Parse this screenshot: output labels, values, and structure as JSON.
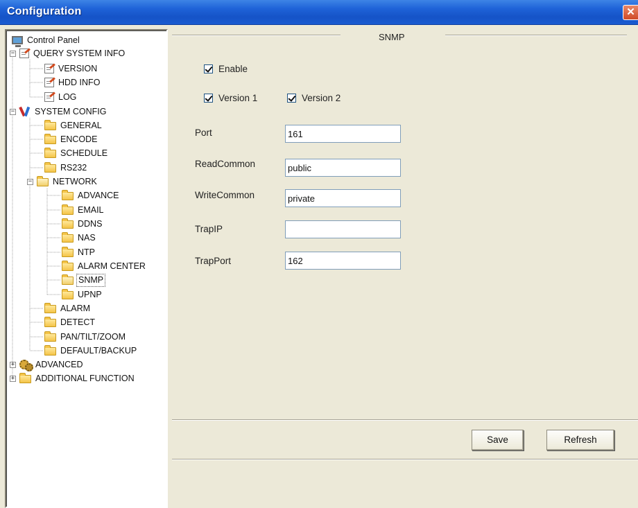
{
  "window": {
    "title": "Configuration",
    "close_glyph": "✕"
  },
  "tree": {
    "root": "Control Panel",
    "query_system_info": "QUERY SYSTEM INFO",
    "version": "VERSION",
    "hdd_info": "HDD INFO",
    "log": "LOG",
    "system_config": "SYSTEM CONFIG",
    "general": "GENERAL",
    "encode": "ENCODE",
    "schedule": "SCHEDULE",
    "rs232": "RS232",
    "network": "NETWORK",
    "advance": "ADVANCE",
    "email": "EMAIL",
    "ddns": "DDNS",
    "nas": "NAS",
    "ntp": "NTP",
    "alarm_center": "ALARM CENTER",
    "snmp": "SNMP",
    "upnp": "UPNP",
    "alarm": "ALARM",
    "detect": "DETECT",
    "pan_tilt_zoom": "PAN/TILT/ZOOM",
    "default_backup": "DEFAULT/BACKUP",
    "advanced": "ADVANCED",
    "additional_function": "ADDITIONAL FUNCTION",
    "expand_minus": "−",
    "expand_plus": "+"
  },
  "snmp": {
    "section_title": "SNMP",
    "enable_label": "Enable",
    "enable_checked": true,
    "version1_label": "Version 1",
    "version1_checked": true,
    "version2_label": "Version 2",
    "version2_checked": true,
    "port_label": "Port",
    "port_value": "161",
    "read_label": "ReadCommon",
    "read_value": "public",
    "write_label": "WriteCommon",
    "write_value": "private",
    "trapip_label": "TrapIP",
    "trapip_value": "",
    "trapport_label": "TrapPort",
    "trapport_value": "162"
  },
  "buttons": {
    "save": "Save",
    "refresh": "Refresh"
  }
}
